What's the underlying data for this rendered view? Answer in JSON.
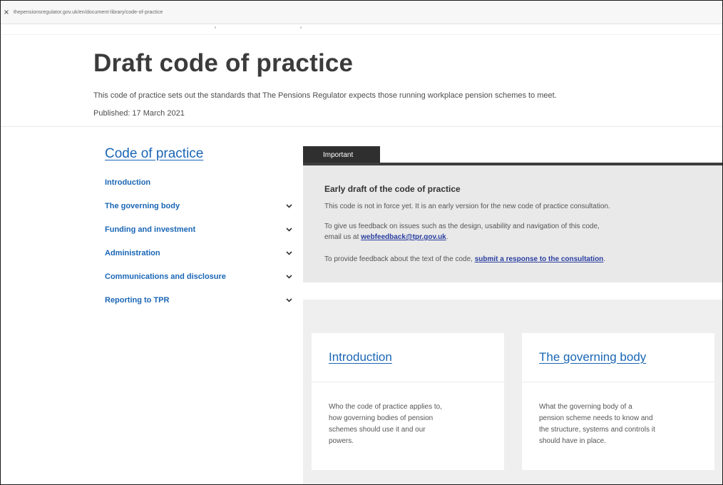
{
  "browser": {
    "url": "thepensionsregulator.gov.uk/en/document-library/code-of-practice"
  },
  "header": {
    "title": "Draft code of practice",
    "description": "This code of practice sets out the standards that The Pensions Regulator expects those running workplace pension schemes to meet.",
    "published": "Published: 17 March 2021"
  },
  "sidebar": {
    "title": "Code of practice",
    "items": [
      {
        "label": "Introduction",
        "has_chevron": false
      },
      {
        "label": "The governing body",
        "has_chevron": true
      },
      {
        "label": "Funding and investment",
        "has_chevron": true
      },
      {
        "label": "Administration",
        "has_chevron": true
      },
      {
        "label": "Communications and disclosure",
        "has_chevron": true
      },
      {
        "label": "Reporting to TPR",
        "has_chevron": true
      }
    ]
  },
  "important": {
    "tab_label": "Important",
    "heading": "Early draft of the code of practice",
    "line1": "This code is not in force yet. It is an early version for the new code of practice consultation.",
    "line2a": "To give us feedback on issues such as the design, usability and navigation of this code,",
    "line2b_prefix": "email us at ",
    "email_link": "webfeedback@tpr.gov.uk",
    "line2b_suffix": ".",
    "line3_prefix": "To provide feedback about the text of the code, ",
    "consultation_link": "submit a response to the consultation",
    "line3_suffix": "."
  },
  "cards": [
    {
      "title": "Introduction",
      "desc_lines": [
        "Who the code of practice applies to,",
        "how governing bodies of pension",
        "schemes should use it and our",
        "powers."
      ]
    },
    {
      "title": "The governing body",
      "desc_lines": [
        "What the governing body of a",
        "pension scheme needs to know and",
        "the structure, systems and controls it",
        "should have in place."
      ]
    }
  ],
  "colors": {
    "link": "#1a66b5",
    "tab_bg": "#2f2f2f",
    "panel_bg": "#e9e9e9",
    "card_area_bg": "#efefef"
  }
}
